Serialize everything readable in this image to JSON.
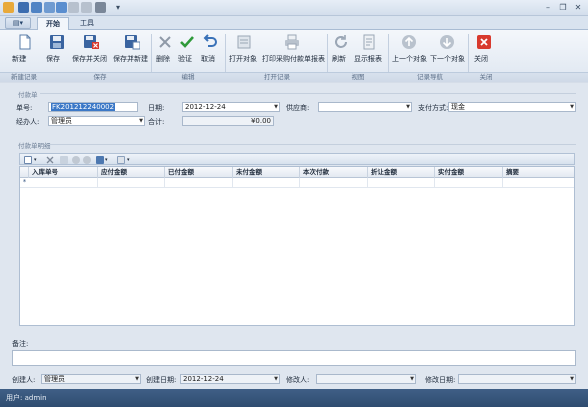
{
  "tabs": {
    "file": "",
    "start": "开始",
    "tools": "工具"
  },
  "ribbon": {
    "new": "新建",
    "save": "保存",
    "save_close": "保存并关闭",
    "save_new": "保存并新建",
    "delete": "删除",
    "validate": "验证",
    "cancel": "取消",
    "open_object": "打开对象",
    "print_payment": "打印采购付款单报表",
    "refresh": "刷新",
    "show_report": "显示报表",
    "prev_object": "上一个对象",
    "next_object": "下一个对象",
    "close": "关闭",
    "groups": {
      "new_record": "新建记录",
      "save": "保存",
      "edit": "编辑",
      "open_record": "打开记录",
      "view": "视图",
      "record_nav": "记录导航",
      "close": "关闭"
    }
  },
  "form": {
    "section_payment": "付款单",
    "number_label": "单号:",
    "number_value": "FK201212240002",
    "date_label": "日期:",
    "date_value": "2012-12-24",
    "supplier_label": "供应商:",
    "supplier_value": "",
    "paymethod_label": "支付方式:",
    "paymethod_value": "现金",
    "handler_label": "经办人:",
    "handler_value": "管理员",
    "total_label": "合计:",
    "total_value": "¥0.00"
  },
  "detail": {
    "section_title": "付款单明细",
    "columns": [
      "入库单号",
      "应付金额",
      "已付金额",
      "未付金额",
      "本次付款",
      "折让金额",
      "实付金额",
      "摘要"
    ]
  },
  "footer": {
    "notes_label": "备注:",
    "creator_label": "创建人:",
    "creator_value": "管理员",
    "created_label": "创建日期:",
    "created_value": "2012-12-24",
    "modifier_label": "修改人:",
    "modifier_value": "",
    "modified_label": "修改日期:",
    "modified_value": ""
  },
  "status": {
    "user": "用户: admin"
  },
  "colors": {
    "accent": "#2f4c70",
    "selection": "#3b78c7",
    "delete_red": "#d83a2e",
    "validate_green": "#2f9a3a"
  }
}
